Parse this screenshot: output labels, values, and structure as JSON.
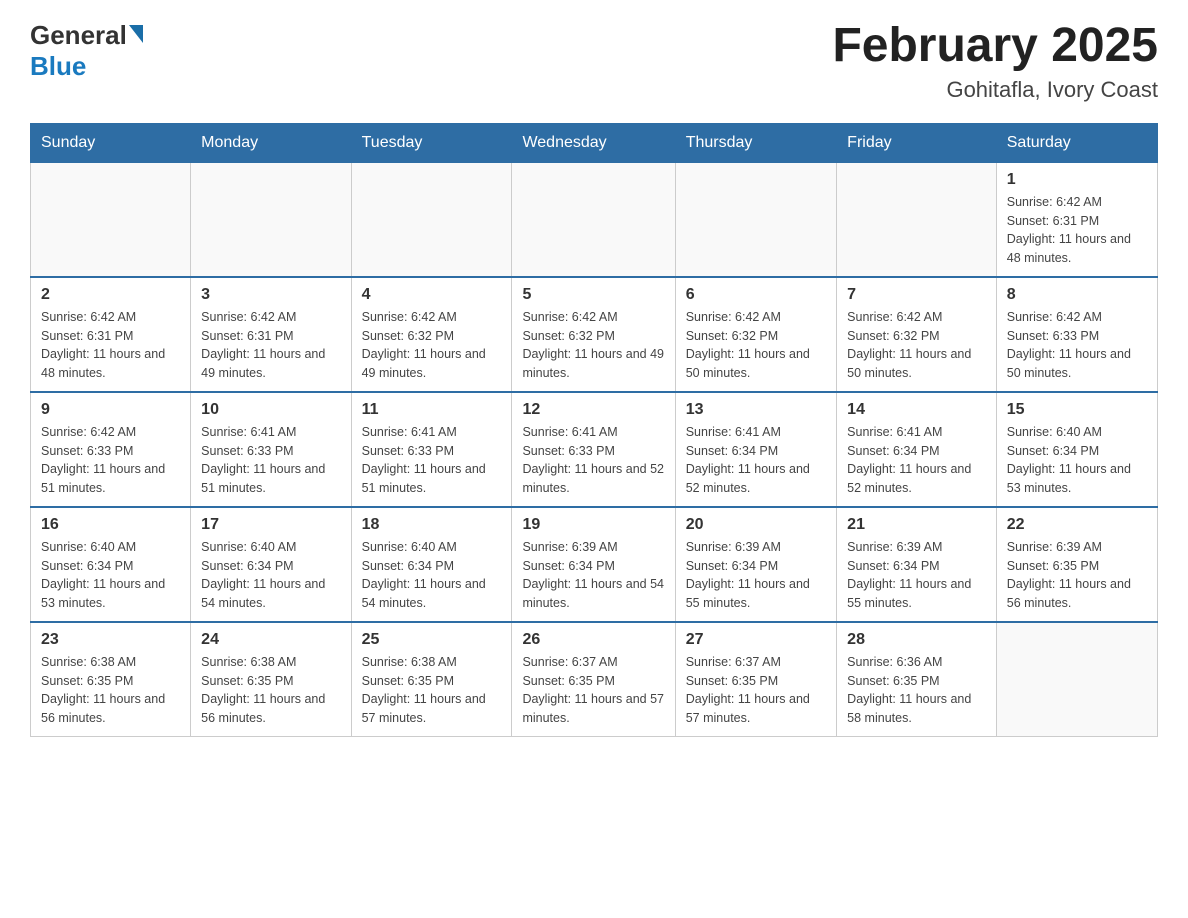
{
  "header": {
    "logo": {
      "general": "General",
      "blue": "Blue"
    },
    "title": "February 2025",
    "location": "Gohitafla, Ivory Coast"
  },
  "weekdays": [
    "Sunday",
    "Monday",
    "Tuesday",
    "Wednesday",
    "Thursday",
    "Friday",
    "Saturday"
  ],
  "weeks": [
    [
      null,
      null,
      null,
      null,
      null,
      null,
      {
        "day": "1",
        "sunrise": "Sunrise: 6:42 AM",
        "sunset": "Sunset: 6:31 PM",
        "daylight": "Daylight: 11 hours and 48 minutes."
      }
    ],
    [
      {
        "day": "2",
        "sunrise": "Sunrise: 6:42 AM",
        "sunset": "Sunset: 6:31 PM",
        "daylight": "Daylight: 11 hours and 48 minutes."
      },
      {
        "day": "3",
        "sunrise": "Sunrise: 6:42 AM",
        "sunset": "Sunset: 6:31 PM",
        "daylight": "Daylight: 11 hours and 49 minutes."
      },
      {
        "day": "4",
        "sunrise": "Sunrise: 6:42 AM",
        "sunset": "Sunset: 6:32 PM",
        "daylight": "Daylight: 11 hours and 49 minutes."
      },
      {
        "day": "5",
        "sunrise": "Sunrise: 6:42 AM",
        "sunset": "Sunset: 6:32 PM",
        "daylight": "Daylight: 11 hours and 49 minutes."
      },
      {
        "day": "6",
        "sunrise": "Sunrise: 6:42 AM",
        "sunset": "Sunset: 6:32 PM",
        "daylight": "Daylight: 11 hours and 50 minutes."
      },
      {
        "day": "7",
        "sunrise": "Sunrise: 6:42 AM",
        "sunset": "Sunset: 6:32 PM",
        "daylight": "Daylight: 11 hours and 50 minutes."
      },
      {
        "day": "8",
        "sunrise": "Sunrise: 6:42 AM",
        "sunset": "Sunset: 6:33 PM",
        "daylight": "Daylight: 11 hours and 50 minutes."
      }
    ],
    [
      {
        "day": "9",
        "sunrise": "Sunrise: 6:42 AM",
        "sunset": "Sunset: 6:33 PM",
        "daylight": "Daylight: 11 hours and 51 minutes."
      },
      {
        "day": "10",
        "sunrise": "Sunrise: 6:41 AM",
        "sunset": "Sunset: 6:33 PM",
        "daylight": "Daylight: 11 hours and 51 minutes."
      },
      {
        "day": "11",
        "sunrise": "Sunrise: 6:41 AM",
        "sunset": "Sunset: 6:33 PM",
        "daylight": "Daylight: 11 hours and 51 minutes."
      },
      {
        "day": "12",
        "sunrise": "Sunrise: 6:41 AM",
        "sunset": "Sunset: 6:33 PM",
        "daylight": "Daylight: 11 hours and 52 minutes."
      },
      {
        "day": "13",
        "sunrise": "Sunrise: 6:41 AM",
        "sunset": "Sunset: 6:34 PM",
        "daylight": "Daylight: 11 hours and 52 minutes."
      },
      {
        "day": "14",
        "sunrise": "Sunrise: 6:41 AM",
        "sunset": "Sunset: 6:34 PM",
        "daylight": "Daylight: 11 hours and 52 minutes."
      },
      {
        "day": "15",
        "sunrise": "Sunrise: 6:40 AM",
        "sunset": "Sunset: 6:34 PM",
        "daylight": "Daylight: 11 hours and 53 minutes."
      }
    ],
    [
      {
        "day": "16",
        "sunrise": "Sunrise: 6:40 AM",
        "sunset": "Sunset: 6:34 PM",
        "daylight": "Daylight: 11 hours and 53 minutes."
      },
      {
        "day": "17",
        "sunrise": "Sunrise: 6:40 AM",
        "sunset": "Sunset: 6:34 PM",
        "daylight": "Daylight: 11 hours and 54 minutes."
      },
      {
        "day": "18",
        "sunrise": "Sunrise: 6:40 AM",
        "sunset": "Sunset: 6:34 PM",
        "daylight": "Daylight: 11 hours and 54 minutes."
      },
      {
        "day": "19",
        "sunrise": "Sunrise: 6:39 AM",
        "sunset": "Sunset: 6:34 PM",
        "daylight": "Daylight: 11 hours and 54 minutes."
      },
      {
        "day": "20",
        "sunrise": "Sunrise: 6:39 AM",
        "sunset": "Sunset: 6:34 PM",
        "daylight": "Daylight: 11 hours and 55 minutes."
      },
      {
        "day": "21",
        "sunrise": "Sunrise: 6:39 AM",
        "sunset": "Sunset: 6:34 PM",
        "daylight": "Daylight: 11 hours and 55 minutes."
      },
      {
        "day": "22",
        "sunrise": "Sunrise: 6:39 AM",
        "sunset": "Sunset: 6:35 PM",
        "daylight": "Daylight: 11 hours and 56 minutes."
      }
    ],
    [
      {
        "day": "23",
        "sunrise": "Sunrise: 6:38 AM",
        "sunset": "Sunset: 6:35 PM",
        "daylight": "Daylight: 11 hours and 56 minutes."
      },
      {
        "day": "24",
        "sunrise": "Sunrise: 6:38 AM",
        "sunset": "Sunset: 6:35 PM",
        "daylight": "Daylight: 11 hours and 56 minutes."
      },
      {
        "day": "25",
        "sunrise": "Sunrise: 6:38 AM",
        "sunset": "Sunset: 6:35 PM",
        "daylight": "Daylight: 11 hours and 57 minutes."
      },
      {
        "day": "26",
        "sunrise": "Sunrise: 6:37 AM",
        "sunset": "Sunset: 6:35 PM",
        "daylight": "Daylight: 11 hours and 57 minutes."
      },
      {
        "day": "27",
        "sunrise": "Sunrise: 6:37 AM",
        "sunset": "Sunset: 6:35 PM",
        "daylight": "Daylight: 11 hours and 57 minutes."
      },
      {
        "day": "28",
        "sunrise": "Sunrise: 6:36 AM",
        "sunset": "Sunset: 6:35 PM",
        "daylight": "Daylight: 11 hours and 58 minutes."
      },
      null
    ]
  ]
}
